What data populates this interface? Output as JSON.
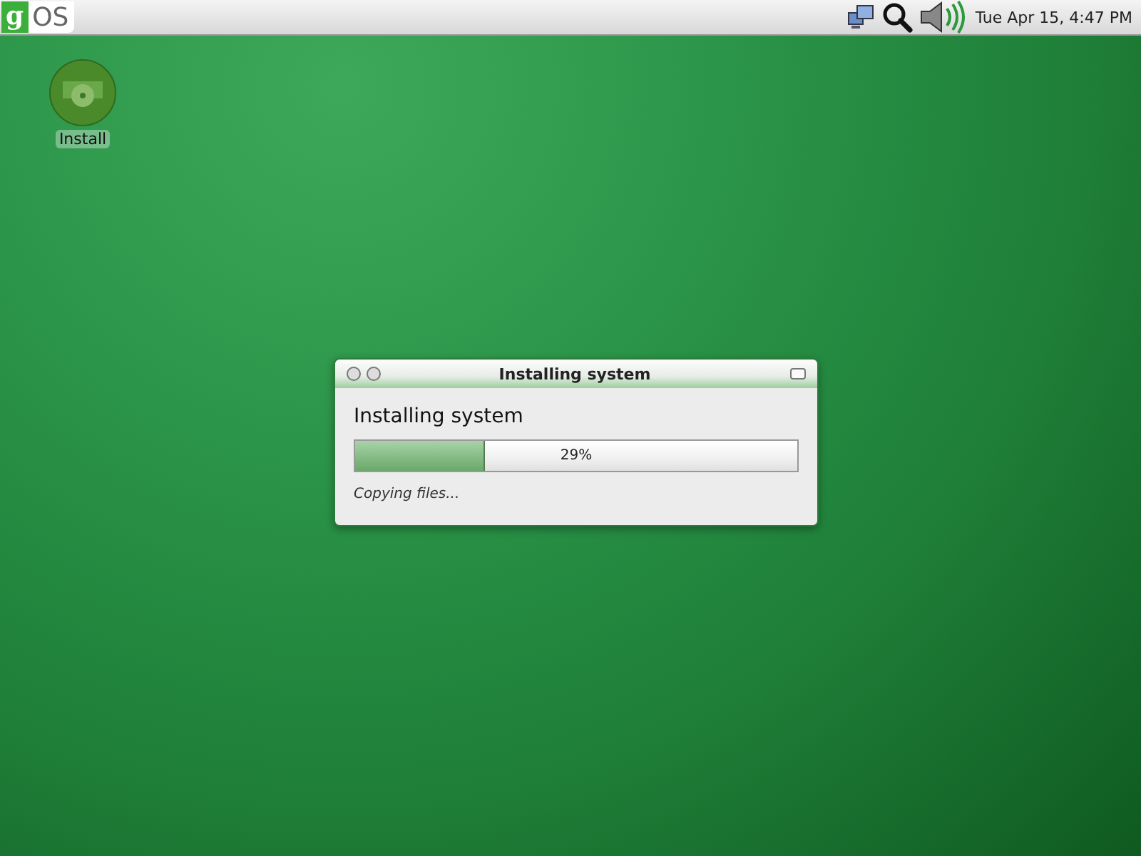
{
  "panel": {
    "logo": {
      "letter": "g",
      "text": "OS"
    },
    "clock": "Tue Apr 15,  4:47 PM"
  },
  "desktop_icons": [
    {
      "label": "Install"
    }
  ],
  "window": {
    "title": "Installing system",
    "heading": "Installing system",
    "progress": {
      "level": 0.29,
      "reading": "29%"
    },
    "status": "Copying files..."
  }
}
